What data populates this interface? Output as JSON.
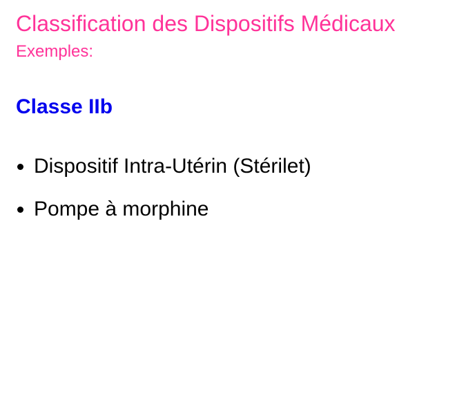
{
  "slide": {
    "title": "Classification des Dispositifs Médicaux",
    "subtitle": "Exemples:",
    "heading": "Classe IIb",
    "bullets": [
      {
        "text": "Dispositif Intra-Utérin (Stérilet)"
      },
      {
        "text": "Pompe à morphine"
      }
    ]
  },
  "colors": {
    "title": "#ff3399",
    "heading": "#0000ee",
    "body": "#000000",
    "background": "#ffffff"
  },
  "icons": {
    "bullet": "bullet-dot-icon"
  }
}
